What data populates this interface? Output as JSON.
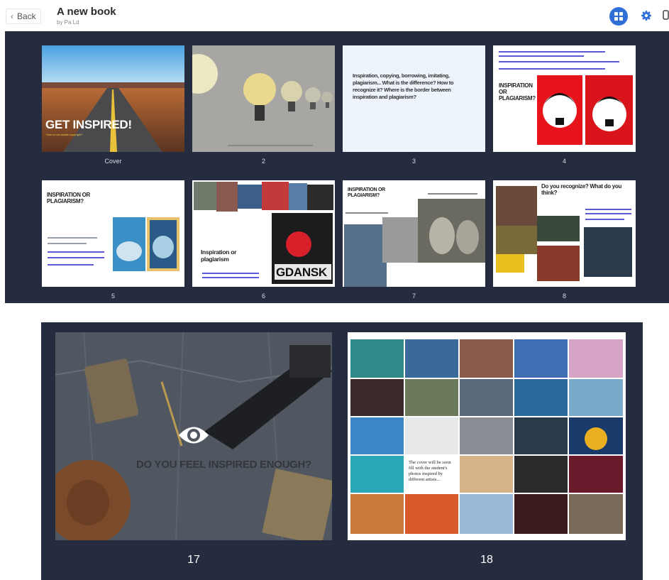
{
  "header": {
    "back_label": "Back",
    "title": "A new book",
    "author": "by Pa Ld"
  },
  "icons": {
    "back": "chevron-left-icon",
    "grid_view": "grid-view-icon",
    "settings": "gear-icon",
    "preview": "eye-icon"
  },
  "colors": {
    "panel_bg": "#262c40",
    "accent": "#2f6fd6"
  },
  "pages": [
    {
      "label": "Cover",
      "heading": "GET INSPIRED!",
      "sub": "How to not violate copyright?"
    },
    {
      "label": "2"
    },
    {
      "label": "3",
      "text": "Inspiration, copying, borrowing, imitating, plagiarism... What is the difference? How to recognize it? Where is the border between inspiration and plagiarism?"
    },
    {
      "label": "4",
      "heading": "INSPIRATION OR PLAGIARISM?"
    },
    {
      "label": "5",
      "heading": "INSPIRATION OR PLAGIARISM?"
    },
    {
      "label": "6",
      "heading": "Inspiration or plagiarism",
      "poster": "GDANSK"
    },
    {
      "label": "7",
      "heading": "INSPIRATION OR PLAGIARISM?"
    },
    {
      "label": "8",
      "heading": "Do you recognize? What do you think?"
    }
  ],
  "large_pages": [
    {
      "label": "17",
      "heading": "DO YOU FEEL INSPIRED ENOUGH?"
    },
    {
      "label": "18",
      "caption": "The cover will be soon fill with the student's photos inspired by different artists..."
    }
  ]
}
